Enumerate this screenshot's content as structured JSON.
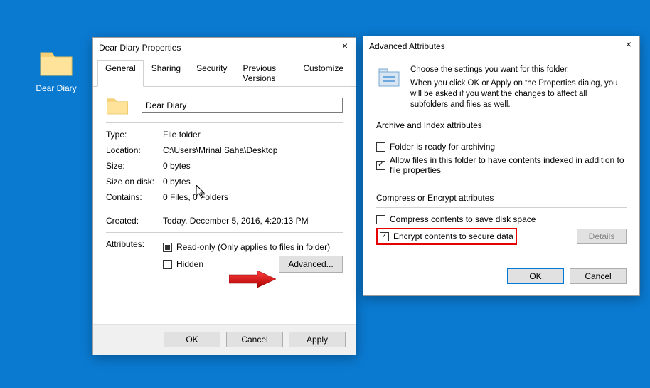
{
  "desktop": {
    "icon_label": "Dear Diary"
  },
  "properties_dialog": {
    "title": "Dear Diary Properties",
    "tabs": [
      "General",
      "Sharing",
      "Security",
      "Previous Versions",
      "Customize"
    ],
    "name_value": "Dear Diary",
    "rows": {
      "type_label": "Type:",
      "type_value": "File folder",
      "location_label": "Location:",
      "location_value": "C:\\Users\\Mrinal Saha\\Desktop",
      "size_label": "Size:",
      "size_value": "0 bytes",
      "sizeondisk_label": "Size on disk:",
      "sizeondisk_value": "0 bytes",
      "contains_label": "Contains:",
      "contains_value": "0 Files, 0 Folders",
      "created_label": "Created:",
      "created_value": "Today, December 5, 2016, 4:20:13 PM",
      "attributes_label": "Attributes:",
      "readonly_label": "Read-only (Only applies to files in folder)",
      "hidden_label": "Hidden",
      "advanced_button": "Advanced..."
    },
    "buttons": {
      "ok": "OK",
      "cancel": "Cancel",
      "apply": "Apply"
    }
  },
  "advanced_dialog": {
    "title": "Advanced Attributes",
    "heading": "Choose the settings you want for this folder.",
    "subtext": "When you click OK or Apply on the Properties dialog, you will be asked if you want the changes to affect all subfolders and files as well.",
    "group1_label": "Archive and Index attributes",
    "archive_label": "Folder is ready for archiving",
    "index_label": "Allow files in this folder to have contents indexed in addition to file properties",
    "group2_label": "Compress or Encrypt attributes",
    "compress_label": "Compress contents to save disk space",
    "encrypt_label": "Encrypt contents to secure data",
    "details_button": "Details",
    "buttons": {
      "ok": "OK",
      "cancel": "Cancel"
    }
  }
}
